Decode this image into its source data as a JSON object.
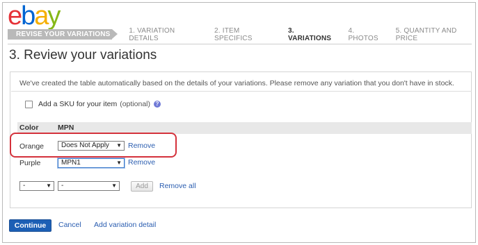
{
  "logo": {
    "e": "e",
    "b": "b",
    "a": "a",
    "y": "y"
  },
  "steps": {
    "current": "REVISE YOUR VARIATIONS",
    "items": [
      "1. VARIATION DETAILS",
      "2. ITEM SPECIFICS",
      "3. VARIATIONS",
      "4. PHOTOS",
      "5. QUANTITY AND PRICE"
    ],
    "active_index": 2
  },
  "page_title": "3. Review your variations",
  "intro": "We've created the table automatically based on the details of your variations. Please remove any variation that you don't have in stock.",
  "sku": {
    "label": "Add a SKU for your item",
    "optional": "(optional)",
    "checked": false,
    "help_icon": "help-icon"
  },
  "table": {
    "headers": [
      "Color",
      "MPN"
    ],
    "rows": [
      {
        "color": "Orange",
        "mpn": "Does Not Apply",
        "remove": "Remove"
      },
      {
        "color": "Purple",
        "mpn": "MPN1",
        "remove": "Remove"
      }
    ],
    "new_row": {
      "color": "-",
      "mpn": "-",
      "add": "Add",
      "remove_all": "Remove all"
    }
  },
  "footer": {
    "continue": "Continue",
    "cancel": "Cancel",
    "add_detail": "Add variation detail"
  },
  "colors": {
    "accent": "#1c5fb5",
    "link": "#2a5db0",
    "highlight": "#d4313b"
  }
}
